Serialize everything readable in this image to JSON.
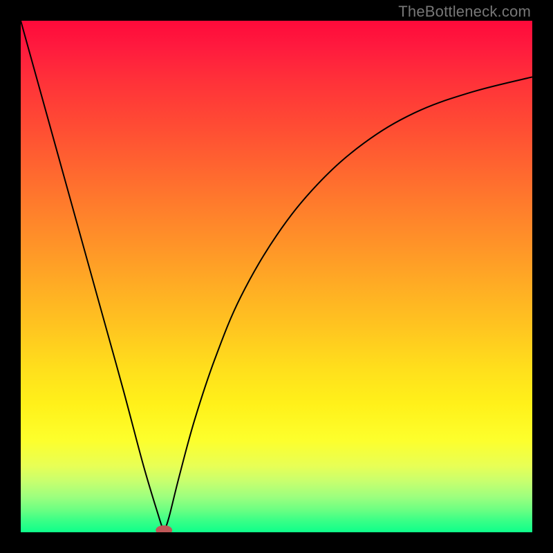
{
  "watermark": "TheBottleneck.com",
  "chart_data": {
    "type": "line",
    "title": "",
    "xlabel": "",
    "ylabel": "",
    "xlim": [
      0,
      100
    ],
    "ylim": [
      0,
      100
    ],
    "vertex_x": 28,
    "marker": {
      "x": 28,
      "y": 0,
      "color": "#c05858"
    },
    "left_curve": [
      {
        "x": 0,
        "y": 100
      },
      {
        "x": 5,
        "y": 82
      },
      {
        "x": 10,
        "y": 64
      },
      {
        "x": 15,
        "y": 46
      },
      {
        "x": 20,
        "y": 28
      },
      {
        "x": 24,
        "y": 13
      },
      {
        "x": 27,
        "y": 3
      },
      {
        "x": 28,
        "y": 0
      }
    ],
    "right_curve": [
      {
        "x": 28,
        "y": 0
      },
      {
        "x": 29,
        "y": 3
      },
      {
        "x": 31,
        "y": 11
      },
      {
        "x": 34,
        "y": 22
      },
      {
        "x": 38,
        "y": 34
      },
      {
        "x": 43,
        "y": 46
      },
      {
        "x": 50,
        "y": 58
      },
      {
        "x": 58,
        "y": 68
      },
      {
        "x": 67,
        "y": 76
      },
      {
        "x": 77,
        "y": 82
      },
      {
        "x": 88,
        "y": 86
      },
      {
        "x": 100,
        "y": 89
      }
    ],
    "background_gradient": {
      "top": "#ff0a3a",
      "mid": "#ffc520",
      "bottom": "#0eff8a"
    }
  }
}
